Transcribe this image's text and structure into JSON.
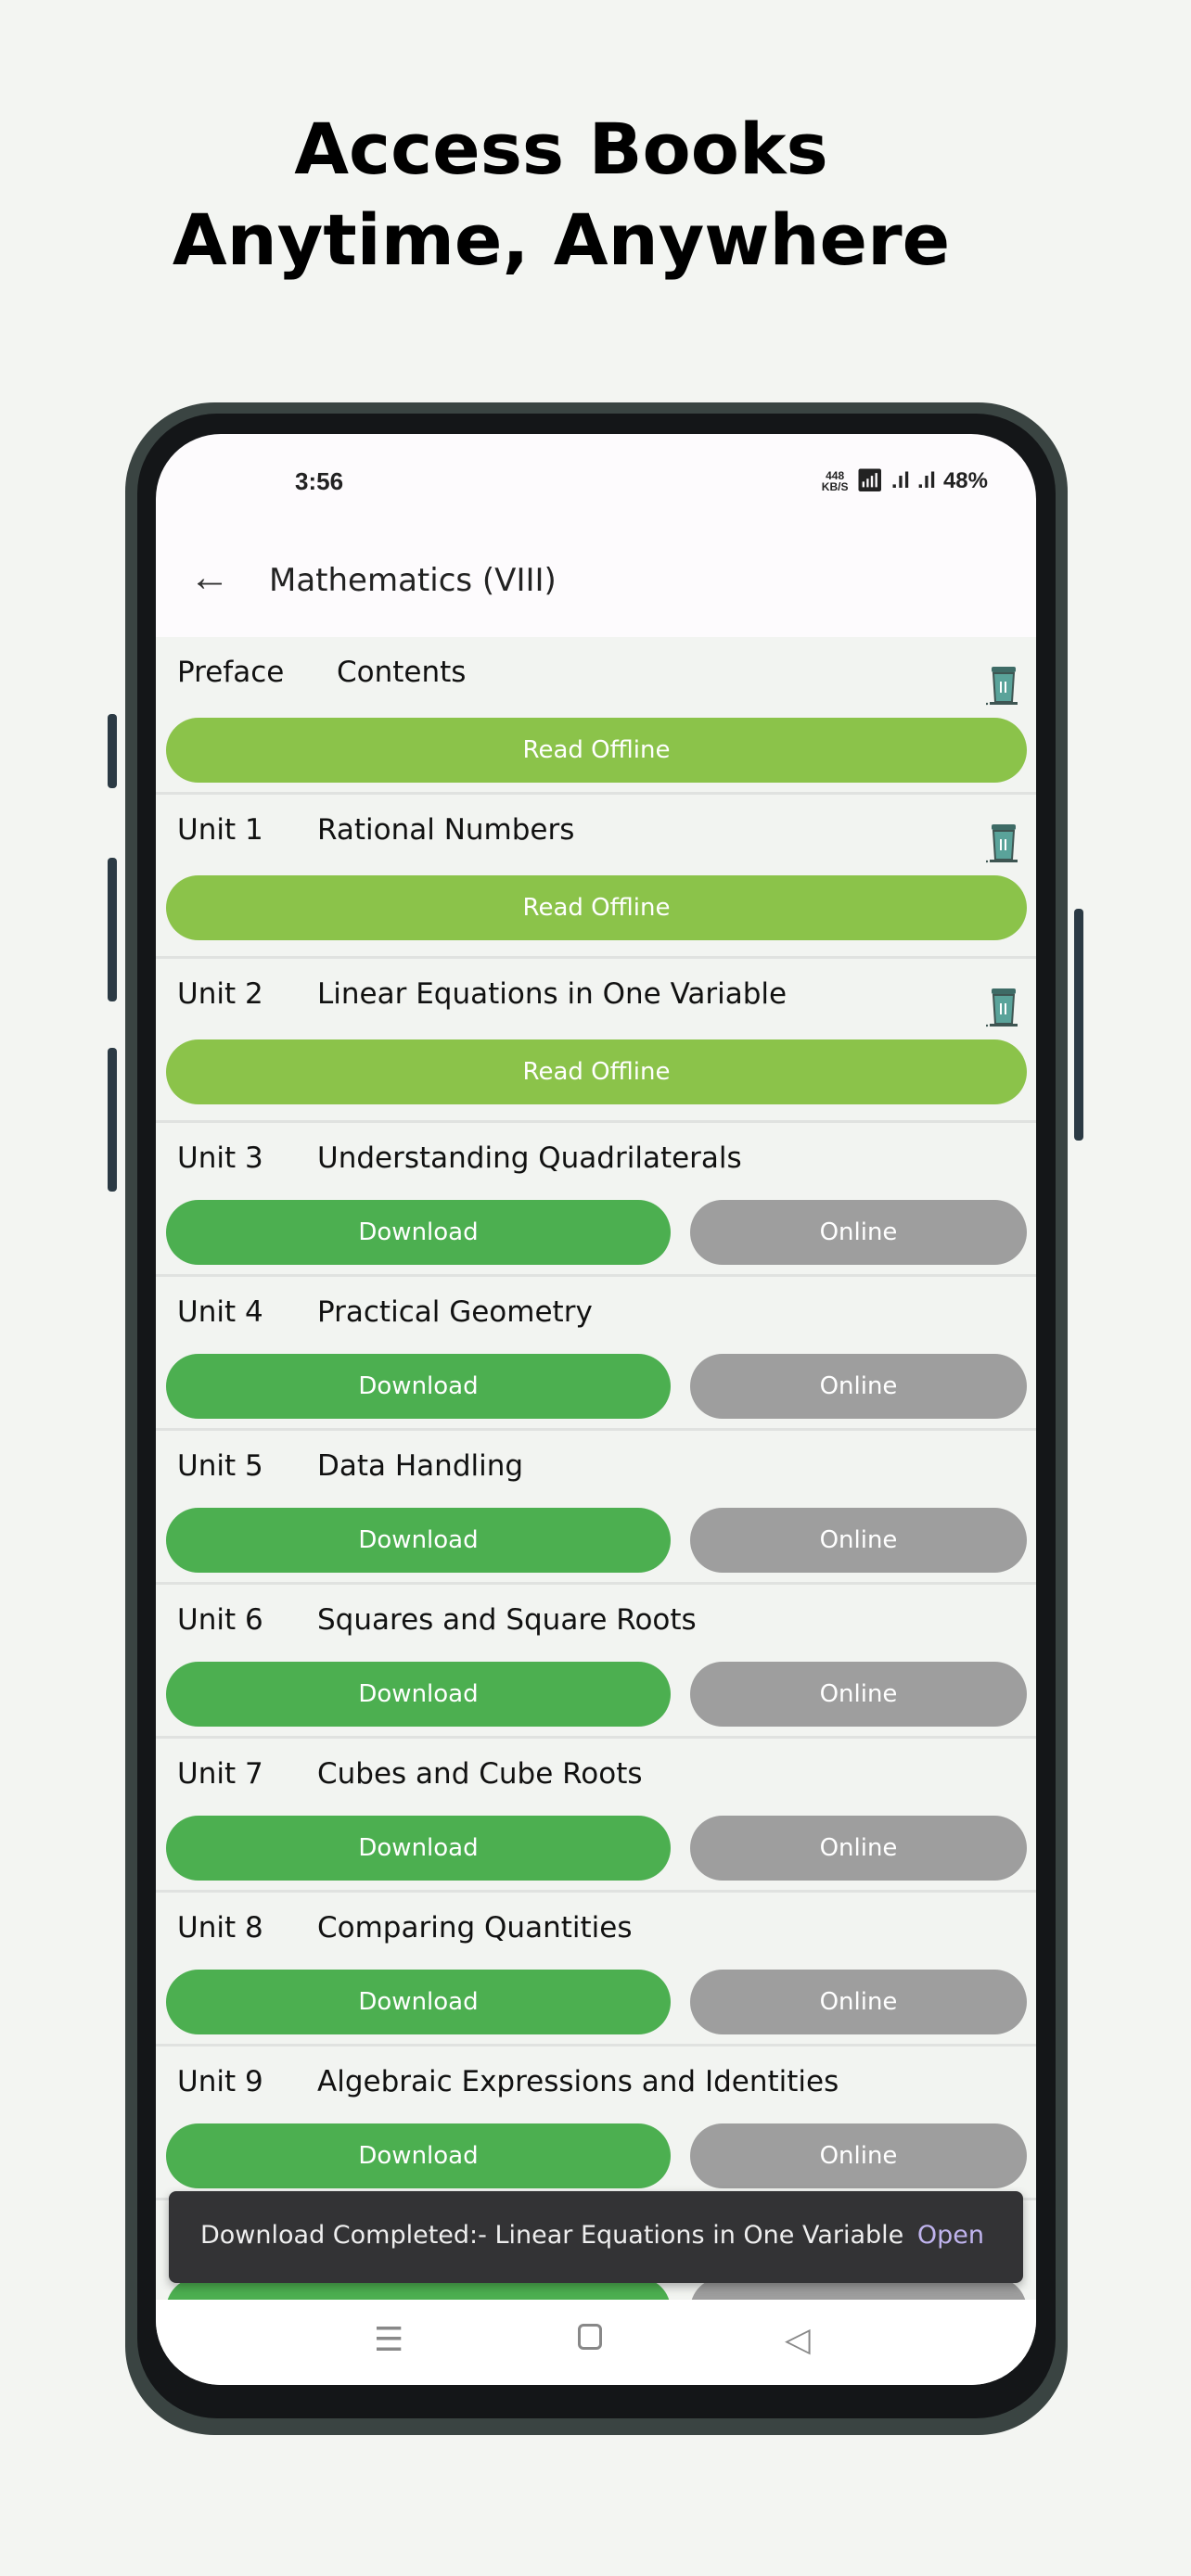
{
  "headline": {
    "line1": "Access Books",
    "line2": "Anytime, Anywhere"
  },
  "status": {
    "time": "3:56",
    "speed": "448",
    "speed_unit": "KB/S",
    "battery": "48%"
  },
  "appbar": {
    "title": "Mathematics (VIII)"
  },
  "rows": [
    {
      "label": "Preface",
      "title": "Contents",
      "state": "downloaded",
      "button": "Read Offline"
    },
    {
      "label": "Unit 1",
      "title": "Rational Numbers",
      "state": "downloaded",
      "button": "Read Offline"
    },
    {
      "label": "Unit 2",
      "title": "Linear Equations in One Variable",
      "state": "downloaded",
      "button": "Read Offline"
    },
    {
      "label": "Unit 3",
      "title": "Understanding Quadrilaterals",
      "state": "online",
      "download": "Download",
      "online": "Online"
    },
    {
      "label": "Unit 4",
      "title": "Practical Geometry",
      "state": "online",
      "download": "Download",
      "online": "Online"
    },
    {
      "label": "Unit 5",
      "title": "Data Handling",
      "state": "online",
      "download": "Download",
      "online": "Online"
    },
    {
      "label": "Unit 6",
      "title": "Squares and Square Roots",
      "state": "online",
      "download": "Download",
      "online": "Online"
    },
    {
      "label": "Unit 7",
      "title": "Cubes and Cube Roots",
      "state": "online",
      "download": "Download",
      "online": "Online"
    },
    {
      "label": "Unit 8",
      "title": "Comparing Quantities",
      "state": "online",
      "download": "Download",
      "online": "Online"
    },
    {
      "label": "Unit 9",
      "title": "Algebraic Expressions and Identities",
      "state": "online",
      "download": "Download",
      "online": "Online"
    }
  ],
  "snackbar": {
    "message": "Download Completed:-  Linear Equations in One Variable",
    "action": "Open"
  },
  "colors": {
    "read_offline": "#8bc34a",
    "download": "#4caf50",
    "online": "#9e9e9e",
    "snackbar": "#333335",
    "action": "#c0b4ee"
  }
}
